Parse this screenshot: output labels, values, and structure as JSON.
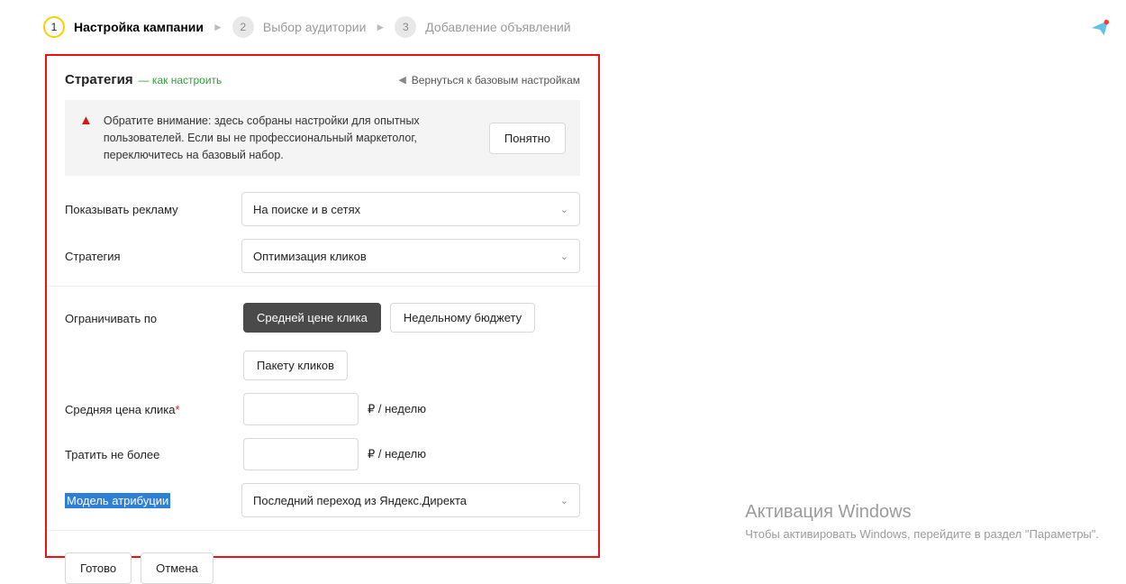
{
  "breadcrumb": {
    "step1_num": "1",
    "step1_label": "Настройка кампании",
    "step2_num": "2",
    "step2_label": "Выбор аудитории",
    "step3_num": "3",
    "step3_label": "Добавление объявлений"
  },
  "panel": {
    "title": "Стратегия",
    "subtitle": "— как настроить",
    "back_label": "Вернуться к базовым настройкам"
  },
  "notice": {
    "text": "Обратите внимание: здесь собраны настройки для опытных пользователей. Если вы не профессиональный маркетолог, переключитесь на базовый набор.",
    "ok_label": "Понятно"
  },
  "fields": {
    "show_ads_label": "Показывать рекламу",
    "show_ads_value": "На поиске и в сетях",
    "strategy_label": "Стратегия",
    "strategy_value": "Оптимизация кликов",
    "limit_by_label": "Ограничивать по",
    "limit_opt1": "Средней цене клика",
    "limit_opt2": "Недельному бюджету",
    "limit_opt3": "Пакету кликов",
    "avg_cpc_label": "Средняя цена клика",
    "avg_cpc_req": "*",
    "avg_cpc_unit": "₽ / неделю",
    "spend_max_label": "Тратить не более",
    "spend_max_unit": "₽ / неделю",
    "attribution_label": "Модель атрибуции",
    "attribution_value": "Последний переход из Яндекс.Директа"
  },
  "footer": {
    "done": "Готово",
    "cancel": "Отмена"
  },
  "watermark": {
    "title": "Активация Windows",
    "line": "Чтобы активировать Windows, перейдите в раздел \"Параметры\"."
  }
}
